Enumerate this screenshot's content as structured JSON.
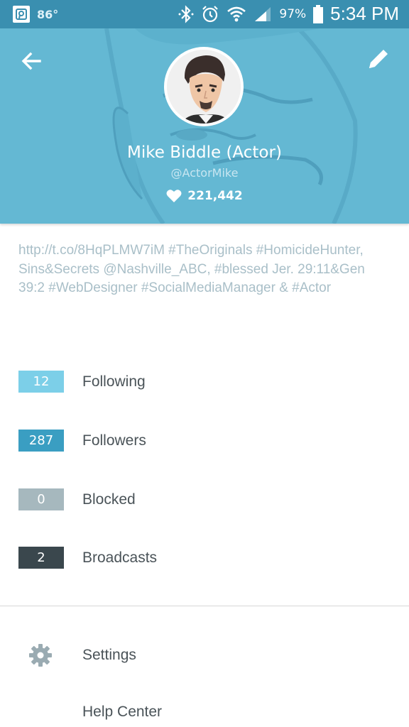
{
  "status_bar": {
    "temperature": "86°",
    "battery_percent": "97%",
    "time": "5:34 PM",
    "icons": [
      "periscope-app-icon",
      "bluetooth-icon",
      "alarm-icon",
      "wifi-icon",
      "signal-icon",
      "battery-icon"
    ]
  },
  "header": {
    "background_color": "#64b8d3",
    "back_icon": "arrow-left-icon",
    "edit_icon": "pencil-icon"
  },
  "profile": {
    "name": "Mike Biddle (Actor)",
    "handle": "@ActorMike",
    "hearts_count": "221,442",
    "bio": "http://t.co/8HqPLMW7iM #TheOriginals #HomicideHunter, Sins&Secrets @Nashville_ABC, #blessed Jer. 29:11&Gen 39:2 #WebDesigner #SocialMediaManager & #Actor"
  },
  "stats": [
    {
      "count": "12",
      "label": "Following",
      "color": "#7ccfe8"
    },
    {
      "count": "287",
      "label": "Followers",
      "color": "#3a9ec2"
    },
    {
      "count": "0",
      "label": "Blocked",
      "color": "#a6b8be"
    },
    {
      "count": "2",
      "label": "Broadcasts",
      "color": "#3a474d"
    }
  ],
  "menu": {
    "settings_label": "Settings",
    "help_label": "Help Center"
  }
}
